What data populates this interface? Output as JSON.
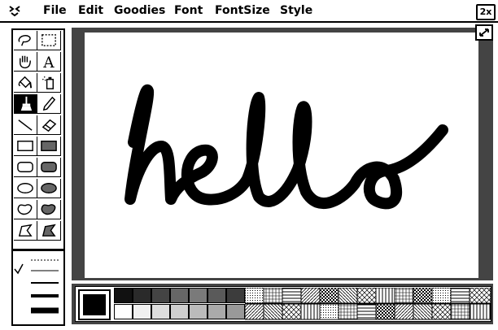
{
  "menu": {
    "items": [
      "File",
      "Edit",
      "Goodies",
      "Font",
      "FontSize",
      "Style"
    ]
  },
  "zoom": {
    "label": "2x"
  },
  "canvas": {
    "drawing_text": "hello"
  },
  "tools": [
    "lasso",
    "select-rect",
    "grabber",
    "text",
    "paint-bucket",
    "spray-can",
    "brush",
    "pencil",
    "line",
    "eraser",
    "rect-empty",
    "rect-filled",
    "rounded-rect-empty",
    "rounded-rect-filled",
    "oval-empty",
    "oval-filled",
    "freeform-empty",
    "freeform-filled",
    "polygon-empty",
    "polygon-filled"
  ],
  "selected_tool": "brush",
  "colors": {
    "frame": "#444444",
    "ink": "#000000",
    "paper": "#ffffff"
  }
}
